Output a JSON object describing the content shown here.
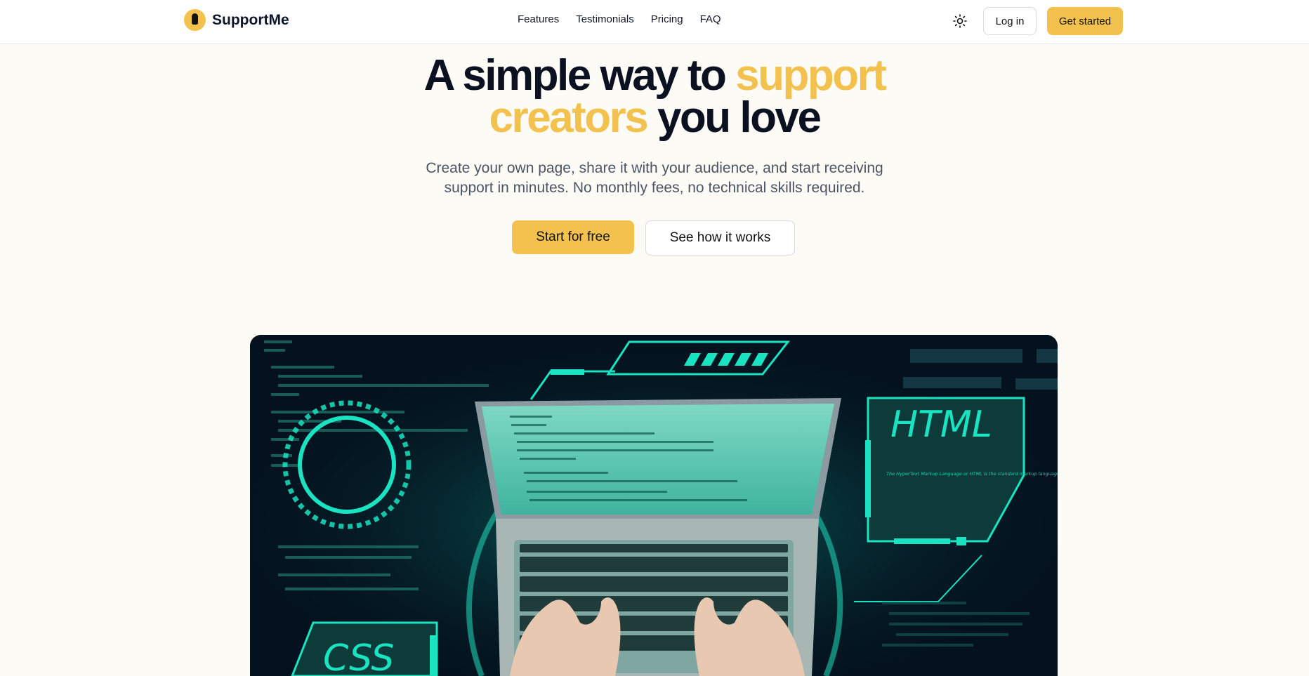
{
  "brand": {
    "name": "SupportMe"
  },
  "nav": {
    "links": [
      "Features",
      "Testimonials",
      "Pricing",
      "FAQ"
    ],
    "login_label": "Log in",
    "get_started_label": "Get started",
    "theme_icon": "sun-icon"
  },
  "hero": {
    "title_part1": "A simple way to ",
    "title_accent1": "support",
    "title_accent2": "creators",
    "title_part2": " you love",
    "subtitle": "Create your own page, share it with your audience, and start receiving support in minutes. No monthly fees, no technical skills required.",
    "cta_primary": "Start for free",
    "cta_secondary": "See how it works"
  },
  "illustration": {
    "html_label": "HTML",
    "html_caption": "The HyperText Markup Language or HTML is the standard markup language for documents designed to be displayed in a web browser. It can be assisted by technologies such as Cascading Style Sheets and scripting languages such as JavaScript.",
    "css_label": "CSS"
  },
  "colors": {
    "accent": "#f2c14e",
    "glow": "#19e3c0",
    "dark": "#04121f"
  }
}
